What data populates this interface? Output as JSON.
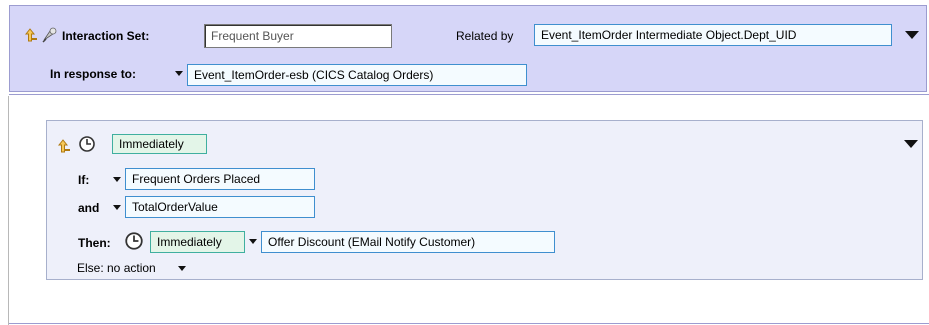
{
  "header": {
    "interaction_set_label": "Interaction Set:",
    "interaction_set_value": "Frequent Buyer",
    "related_by_label": "Related by",
    "related_by_value": "Event_ItemOrder Intermediate Object.Dept_UID",
    "in_response_label": "In response to:",
    "in_response_value": "Event_ItemOrder-esb (CICS Catalog Orders)"
  },
  "rule": {
    "timing": "Immediately",
    "if_label": "If:",
    "if_value": "Frequent Orders Placed",
    "and_label": "and",
    "and_value": "TotalOrderValue",
    "then_label": "Then:",
    "then_timing": "Immediately",
    "then_action": "Offer Discount (EMail Notify Customer)",
    "else_text": "Else: no action"
  },
  "icons": {
    "up_arrow": "promote-arrow-icon",
    "interaction": "interaction-set-icon",
    "clock": "clock-icon",
    "dropdown": "dropdown-triangle-icon"
  },
  "colors": {
    "header_bg": "#d6d6f8",
    "rule_bg": "#eef0fa",
    "box_border": "#3f8fcf",
    "green_box": "#e3f5e8"
  }
}
